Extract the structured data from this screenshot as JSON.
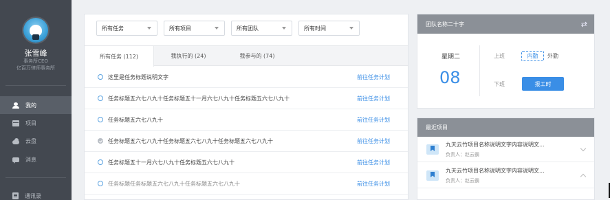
{
  "sidebar": {
    "user": {
      "name": "张雪峰",
      "title": "事务所CEO",
      "company": "亿百万律师事务所"
    },
    "nav": [
      {
        "label": "我的",
        "icon": "person-icon",
        "active": true
      },
      {
        "label": "项目",
        "icon": "table-icon",
        "active": false
      },
      {
        "label": "云盘",
        "icon": "cloud-icon",
        "active": false
      },
      {
        "label": "消息",
        "icon": "message-icon",
        "active": false
      },
      {
        "label": "通讯录",
        "icon": "contacts-icon",
        "active": false
      }
    ]
  },
  "filters": [
    "所有任务",
    "所有项目",
    "所有团队",
    "所有时间"
  ],
  "tabs": [
    "所有任务 (112)",
    "我执行的 (24)",
    "我参与的 (74)"
  ],
  "tasks": [
    {
      "title": "这里是任务标题说明文字",
      "link": "前往任务计划",
      "done": false
    },
    {
      "title": "任务标题五六七八九十任务标题五十一月六七八九十任务标题五六七八九十",
      "link": "前往任务计划",
      "done": false
    },
    {
      "title": "任务标题五六七八九十",
      "link": "前往任务计划",
      "done": false
    },
    {
      "title": "任务标题五六七八九十任务标题五六七八九十任务标题五六七八九十",
      "link": "前往任务计划",
      "done": true
    },
    {
      "title": "任务标题五十一月六七八九十任务标题五六七八九十",
      "link": "前往任务计划",
      "done": false
    },
    {
      "title": "任务标题任务标题五六七八九十任务标题五六七八九十",
      "link": "前往任务计划",
      "done": false
    }
  ],
  "team": {
    "name": "团队名称二十字",
    "weekday": "星期二",
    "day": "08",
    "on_label": "上班",
    "in_label": "内勤",
    "out_label": "外勤",
    "off_label": "下班",
    "report_button": "报工时"
  },
  "recent": {
    "title": "最近项目",
    "items": [
      {
        "title": "九天云竹项目名称说明文字内容说明文...",
        "owner": "负责人：赵云霸",
        "expanded": false
      },
      {
        "title": "九天云竹项目名称说明文字内容说明文...",
        "owner": "负责人：赵云霸",
        "expanded": true
      }
    ]
  },
  "colors": {
    "accent": "#3a8ee6",
    "sidebar": "#434850",
    "header_gray": "#8b9097"
  }
}
